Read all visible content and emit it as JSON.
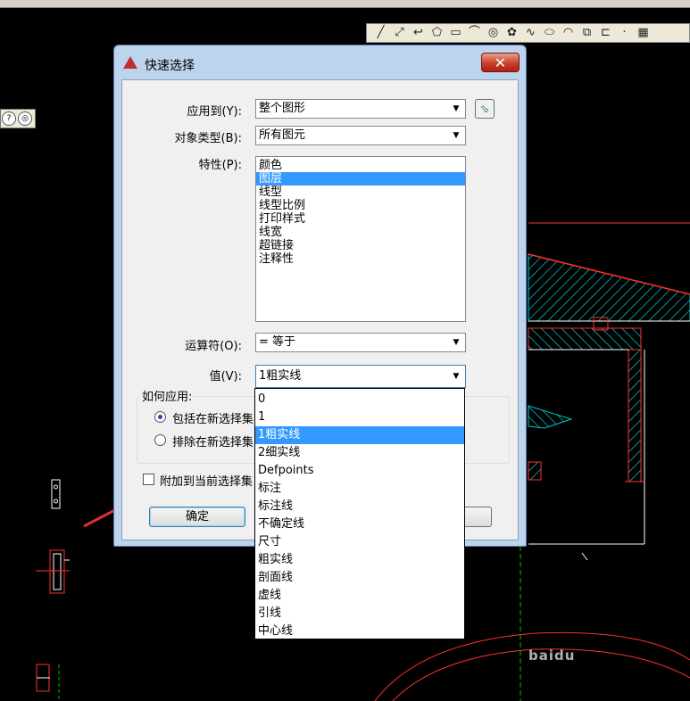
{
  "dialog": {
    "title": "快速选择",
    "close_glyph": "✕",
    "apply_to": {
      "label": "应用到(Y):",
      "value": "整个图形"
    },
    "object_type": {
      "label": "对象类型(B):",
      "value": "所有图元"
    },
    "properties": {
      "label": "特性(P):",
      "items": [
        "颜色",
        "图层",
        "线型",
        "线型比例",
        "打印样式",
        "线宽",
        "超链接",
        "注释性"
      ],
      "selected": "图层"
    },
    "operator": {
      "label": "运算符(O):",
      "value": "= 等于"
    },
    "value": {
      "label": "值(V):",
      "value": "1粗实线"
    },
    "how_to_apply": {
      "title": "如何应用:",
      "include": "包括在新选择集",
      "exclude": "排除在新选择集"
    },
    "append_label": "附加到当前选择集",
    "ok_label": "确定"
  },
  "value_dropdown": {
    "options": [
      "0",
      "1",
      "1粗实线",
      "2细实线",
      "Defpoints",
      "标注",
      "标注线",
      "不确定线",
      "尺寸",
      "粗实线",
      "剖面线",
      "虚线",
      "引线",
      "中心线"
    ],
    "selected": "1粗实线"
  },
  "icons": {
    "toolbar": [
      "line-icon",
      "construction-line-icon",
      "polyline-icon",
      "polygon-icon",
      "rectangle-icon",
      "arc-icon",
      "circle-icon",
      "revcloud-icon",
      "spline-icon",
      "ellipse-icon",
      "ellipse-arc-icon",
      "insert-block-icon",
      "make-block-icon",
      "point-icon",
      "hatch-icon"
    ]
  },
  "watermark": "baidu",
  "colors": {
    "annotation_arrow": "#e03030",
    "cad_red": "#ff0000",
    "cad_cyan": "#00c8c8",
    "cad_white": "#ffffff",
    "cad_green": "#00c000",
    "selection": "#3399ff"
  }
}
